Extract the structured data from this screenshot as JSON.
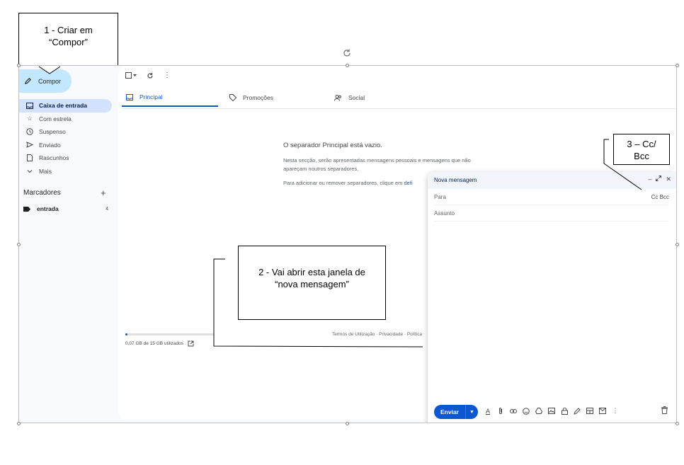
{
  "callouts": {
    "c1_line1": "1 - Criar em",
    "c1_line2": "“Compor”",
    "c2_line1": "2 - Vai abrir esta janela de",
    "c2_line2": "“nova mensagem”",
    "c3_line1": "3 – Cc/",
    "c3_line2": "Bcc"
  },
  "sidebar": {
    "compose_label": "Compor",
    "items": [
      {
        "label": "Caixa de entrada",
        "icon": "inbox-icon"
      },
      {
        "label": "Com estrela",
        "icon": "star-icon"
      },
      {
        "label": "Suspenso",
        "icon": "clock-icon"
      },
      {
        "label": "Enviado",
        "icon": "send-icon"
      },
      {
        "label": "Rascunhos",
        "icon": "draft-icon"
      },
      {
        "label": "Mais",
        "icon": "chevron-down-icon"
      }
    ],
    "labels_heading": "Marcadores",
    "label_name": "entrada",
    "label_count": "4"
  },
  "tabs": {
    "principal": "Principal",
    "promocoes": "Promoções",
    "social": "Social"
  },
  "empty": {
    "title": "O separador Principal está vazio.",
    "line1": "Nesta secção, serão apresentadas mensagens pessoais e mensagens que não",
    "line2": "apareçam noutros separadores.",
    "line3": "Para adicionar ou remover separadores, clique em",
    "link": "defi"
  },
  "storage": {
    "text": "0,07 GB de 15 GB utilizados",
    "fraction": 0.0047
  },
  "footer": {
    "links": "Termos de Utilização · Privacidade · Política"
  },
  "compose": {
    "title": "Nova mensagem",
    "to_label": "Para",
    "cc_bcc": "Cc Bcc",
    "subject_placeholder": "Assunto",
    "send_label": "Enviar"
  },
  "colors": {
    "accent": "#0b57d0",
    "compose_bg": "#c2e7ff",
    "active_nav": "#d3e3fd"
  }
}
